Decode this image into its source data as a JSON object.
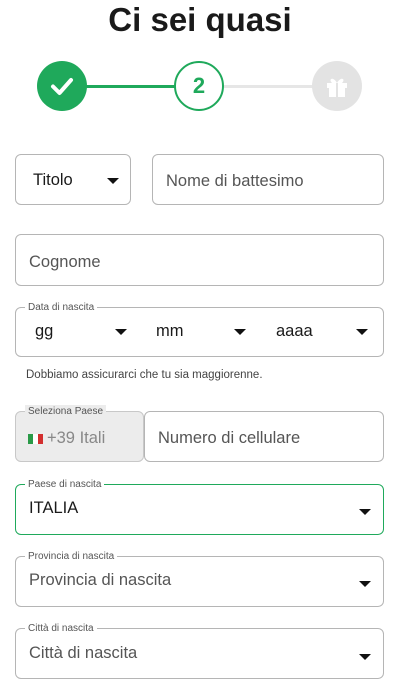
{
  "page": {
    "title": "Ci sei quasi"
  },
  "stepper": {
    "current_step": "2",
    "accent": "#1fa95b"
  },
  "form": {
    "title_select": {
      "value": "Titolo"
    },
    "first_name": {
      "placeholder": "Nome di battesimo"
    },
    "last_name": {
      "placeholder": "Cognome"
    },
    "birth_date": {
      "legend": "Data di nascita",
      "day": "gg",
      "month": "mm",
      "year": "aaaa"
    },
    "age_hint": "Dobbiamo assicurarci che tu sia maggiorenne.",
    "country_select": {
      "legend": "Seleziona Paese",
      "value": "+39 Itali"
    },
    "mobile": {
      "placeholder": "Numero di cellulare"
    },
    "birth_country": {
      "legend": "Paese di nascita",
      "value": "ITALIA"
    },
    "birth_province": {
      "legend": "Provincia di nascita",
      "placeholder": "Provincia di nascita"
    },
    "birth_city": {
      "legend": "Città di nascita",
      "placeholder": "Città di nascita"
    }
  }
}
